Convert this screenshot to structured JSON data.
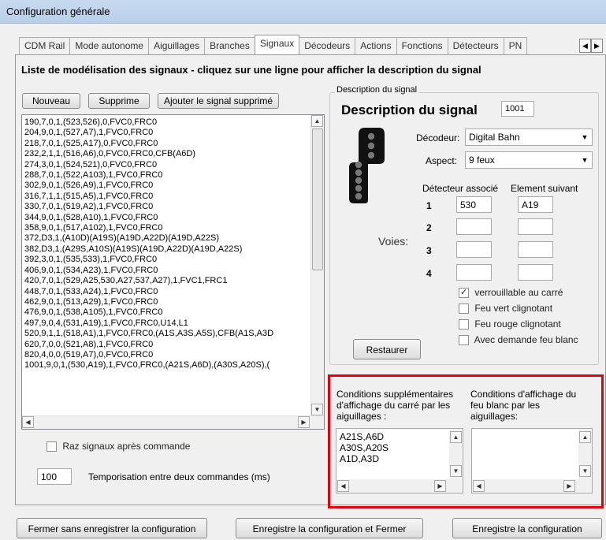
{
  "window": {
    "title": "Configuration générale"
  },
  "tabs": [
    "CDM Rail",
    "Mode autonome",
    "Aiguillages",
    "Branches",
    "Signaux",
    "Décodeurs",
    "Actions",
    "Fonctions",
    "Détecteurs",
    "PN"
  ],
  "active_tab": "Signaux",
  "heading": "Liste de modélisation des signaux - cliquez sur une ligne pour afficher la description du signal",
  "list_buttons": {
    "new": "Nouveau",
    "delete": "Supprime",
    "add_deleted": "Ajouter le signal supprimé"
  },
  "signals": [
    "190,7,0,1,(523,526),0,FVC0,FRC0",
    "204,9,0,1,(527,A7),1,FVC0,FRC0",
    "218,7,0,1,(525,A17),0,FVC0,FRC0",
    "232,2,1,1,(516,A6),0,FVC0,FRC0,CFB(A6D)",
    "274,3,0,1,(524,521),0,FVC0,FRC0",
    "288,7,0,1,(522,A103),1,FVC0,FRC0",
    "302,9,0,1,(526,A9),1,FVC0,FRC0",
    "316,7,1,1,(515,A5),1,FVC0,FRC0",
    "330,7,0,1,(519,A2),1,FVC0,FRC0",
    "344,9,0,1,(528,A10),1,FVC0,FRC0",
    "358,9,0,1,(517,A102),1,FVC0,FRC0",
    "372,D3,1,(A10D)(A19S)(A19D,A22D)(A19D,A22S)",
    "382,D3,1,(A29S,A10S)(A19S)(A19D,A22D)(A19D,A22S)",
    "392,3,0,1,(535,533),1,FVC0,FRC0",
    "406,9,0,1,(534,A23),1,FVC0,FRC0",
    "420,7,0,1,(529,A25,530,A27,537,A27),1,FVC1,FRC1",
    "448,7,0,1,(533,A24),1,FVC0,FRC0",
    "462,9,0,1,(513,A29),1,FVC0,FRC0",
    "476,9,0,1,(538,A105),1,FVC0,FRC0",
    "497,9,0,4,(531,A19),1,FVC0,FRC0,U14,L1",
    "520,9,1,1,(518,A1),1,FVC0,FRC0,(A1S,A3S,A5S),CFB(A1S,A3D",
    "620,7,0,0,(521,A8),1,FVC0,FRC0",
    "820,4,0,0,(519,A7),0,FVC0,FRC0",
    "1001,9,0,1,(530,A19),1,FVC0,FRC0,(A21S,A6D),(A30S,A20S),("
  ],
  "raz_label": "Raz signaux après commande",
  "tempo": {
    "value": "100",
    "label": "Temporisation entre deux commandes (ms)"
  },
  "description": {
    "group_title": "Description du signal",
    "heading": "Description du signal",
    "number": "1001",
    "decoder_label": "Décodeur:",
    "decoder_value": "Digital Bahn",
    "aspect_label": "Aspect:",
    "aspect_value": "9 feux",
    "col_detector": "Détecteur associé",
    "col_next": "Element suivant",
    "voies_label": "Voies:",
    "rows": [
      {
        "num": "1",
        "detector": "530",
        "next": "A19"
      },
      {
        "num": "2",
        "detector": "",
        "next": ""
      },
      {
        "num": "3",
        "detector": "",
        "next": ""
      },
      {
        "num": "4",
        "detector": "",
        "next": ""
      }
    ],
    "checkboxes": [
      {
        "label": "verrouillable au carré",
        "checked": true
      },
      {
        "label": "Feu vert clignotant",
        "checked": false
      },
      {
        "label": "Feu rouge clignotant",
        "checked": false
      },
      {
        "label": "Avec demande feu blanc",
        "checked": false
      }
    ],
    "restore_button": "Restaurer"
  },
  "conditions": {
    "carre_label": "Conditions supplémentaires d'affichage du carré par les aiguillages :",
    "carre_lines": [
      "A21S,A6D",
      "A30S,A20S",
      "A1D,A3D"
    ],
    "blanc_label": "Conditions d'affichage du feu blanc par les aiguillages:",
    "blanc_lines": []
  },
  "footer": {
    "close_no_save": "Fermer sans enregistrer la configuration",
    "save_close": "Enregistre la configuration et Fermer",
    "save": "Enregistre la configuration"
  },
  "colors": {
    "highlight": "#e3000f",
    "title_bar": "#c7d9ee"
  },
  "icons": [
    "signal-9-lights-icon",
    "check-icon",
    "scroll-up-icon",
    "scroll-down-icon",
    "scroll-left-icon",
    "scroll-right-icon",
    "dropdown-arrow-icon"
  ]
}
